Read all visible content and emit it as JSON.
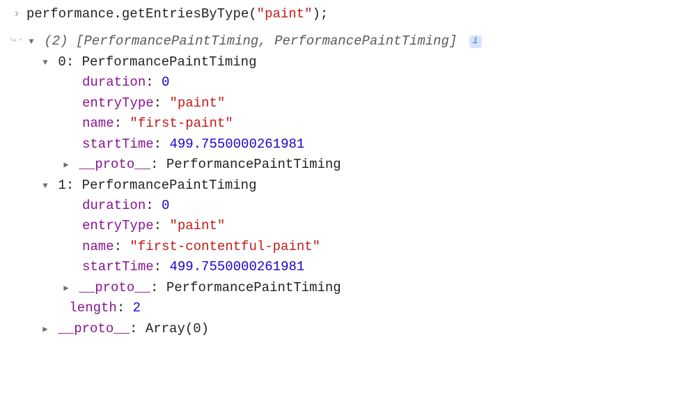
{
  "input": {
    "object": "performance",
    "dot": ".",
    "method": "getEntriesByType",
    "open": "(",
    "arg": "\"paint\"",
    "close": ")",
    "semi": ";"
  },
  "summary": {
    "count": "(2)",
    "open": " [",
    "t1": "PerformancePaintTiming",
    "comma": ", ",
    "t2": "PerformancePaintTiming",
    "close": "]"
  },
  "entries": [
    {
      "index": "0",
      "type": "PerformancePaintTiming",
      "props": {
        "duration_k": "duration",
        "duration_v": "0",
        "entryType_k": "entryType",
        "entryType_v": "\"paint\"",
        "name_k": "name",
        "name_v": "\"first-paint\"",
        "startTime_k": "startTime",
        "startTime_v": "499.7550000261981",
        "proto_k": "__proto__",
        "proto_v": "PerformancePaintTiming"
      }
    },
    {
      "index": "1",
      "type": "PerformancePaintTiming",
      "props": {
        "duration_k": "duration",
        "duration_v": "0",
        "entryType_k": "entryType",
        "entryType_v": "\"paint\"",
        "name_k": "name",
        "name_v": "\"first-contentful-paint\"",
        "startTime_k": "startTime",
        "startTime_v": "499.7550000261981",
        "proto_k": "__proto__",
        "proto_v": "PerformancePaintTiming"
      }
    }
  ],
  "array_tail": {
    "length_k": "length",
    "length_v": "2",
    "proto_k": "__proto__",
    "proto_v": "Array(0)"
  },
  "sep": ": "
}
